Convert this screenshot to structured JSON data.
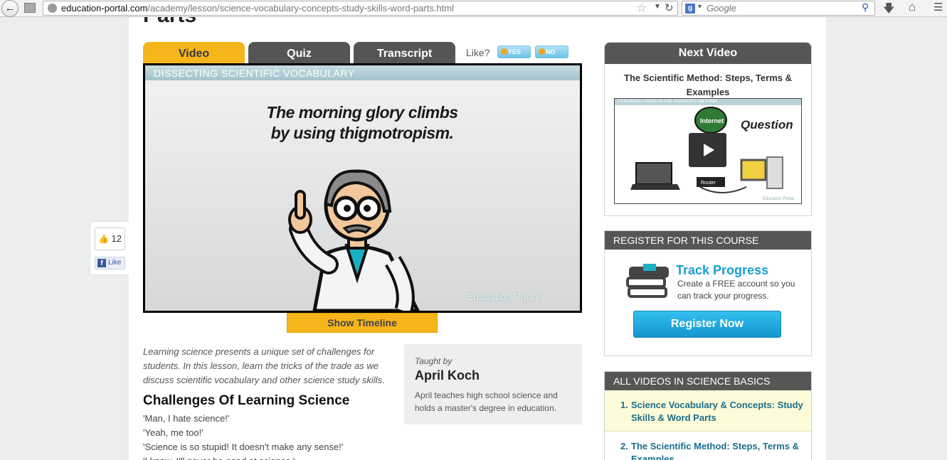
{
  "browser": {
    "url_domain": "education-portal.com",
    "url_path": "/academy/lesson/science-vocabulary-concepts-study-skills-word-parts.html",
    "search_placeholder": "Google",
    "search_engine_badge": "g"
  },
  "page": {
    "title_fragment": "Parts"
  },
  "lesson_tabs": {
    "video": "Video",
    "quiz": "Quiz",
    "transcript": "Transcript"
  },
  "like_prompt": {
    "label": "Like?",
    "yes": "YES",
    "no": "NO"
  },
  "video": {
    "header": "DISSECTING SCIENTIFIC VOCABULARY",
    "caption_line1": "The morning glory climbs",
    "caption_line2": "by using thigmotropism.",
    "watermark": "Education Portal",
    "show_timeline": "Show Timeline"
  },
  "summary": "Learning science presents a unique set of challenges for students. In this lesson, learn the tricks of the trade as we discuss scientific vocabulary and other science study skills.",
  "section_heading": "Challenges Of Learning Science",
  "transcript_lines": [
    "'Man, I hate science!'",
    "'Yeah, me too!'",
    "'Science is so stupid! It doesn't make any sense!'",
    "'I know, I'll never be good at science.'"
  ],
  "instructor": {
    "taught_by": "Taught by",
    "name": "April Koch",
    "bio": "April teaches high school science and holds a master's degree in education."
  },
  "next_video": {
    "header": "Next Video",
    "title": "The Scientific Method: Steps, Terms & Examples",
    "thumb_strip": "FEEDBACK LOOPS IN THE SCIENTIFIC METHOD",
    "thumb_question": "Question",
    "thumb_internet": "Internet",
    "thumb_router": "Router",
    "thumb_watermark": "Education Portal"
  },
  "register": {
    "header": "REGISTER FOR THIS COURSE",
    "track_title": "Track Progress",
    "track_text": "Create a FREE account so you can track your progress.",
    "button": "Register Now"
  },
  "all_videos": {
    "header": "ALL VIDEOS IN SCIENCE BASICS",
    "items": [
      {
        "num": "1.",
        "title": "Science Vocabulary & Concepts: Study Skills & Word Parts"
      },
      {
        "num": "2.",
        "title": "The Scientific Method: Steps, Terms & Examples"
      }
    ]
  },
  "social": {
    "like_count": "12",
    "fb_like": "Like",
    "fb_letter": "f"
  },
  "colors": {
    "active_tab": "#f5b51b",
    "inactive_tab": "#555555",
    "link_blue": "#1b6e8c",
    "accent_cyan": "#1a9fd4"
  }
}
